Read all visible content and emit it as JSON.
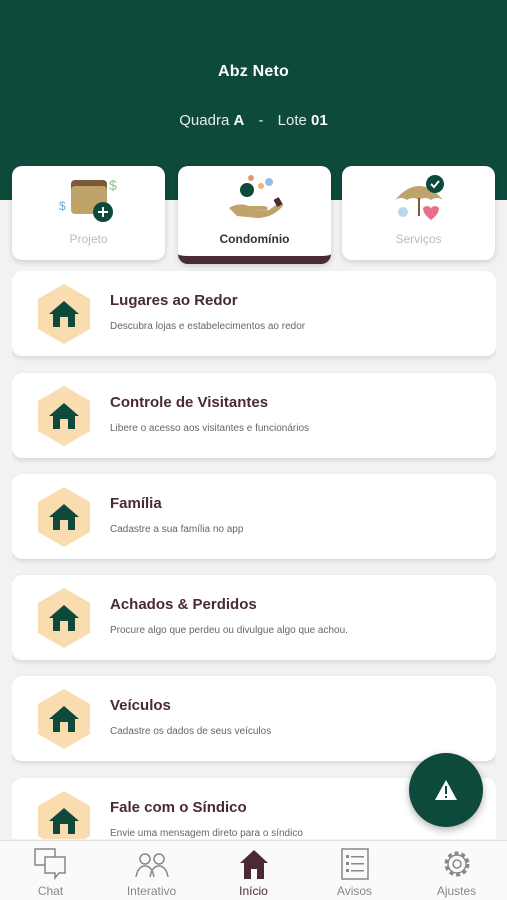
{
  "header": {
    "user_name": "Abz Neto",
    "quadra_label": "Quadra",
    "quadra_value": "A",
    "separator": "-",
    "lote_label": "Lote",
    "lote_value": "01"
  },
  "tabs": [
    {
      "label": "Projeto",
      "icon": "wallet-icon",
      "active": false
    },
    {
      "label": "Condomínio",
      "icon": "hand-coins-icon",
      "active": true
    },
    {
      "label": "Serviços",
      "icon": "umbrella-icon",
      "active": false
    }
  ],
  "list": [
    {
      "title": "Lugares ao Redor",
      "description": "Descubra lojas e estabelecimentos ao redor",
      "icon": "home-icon"
    },
    {
      "title": "Controle de Visitantes",
      "description": "Libere o acesso aos visitantes e funcionários",
      "icon": "home-icon"
    },
    {
      "title": "Família",
      "description": "Cadastre a sua família no app",
      "icon": "home-icon"
    },
    {
      "title": "Achados & Perdidos",
      "description": "Procure algo que perdeu ou divulgue algo que achou.",
      "icon": "home-icon"
    },
    {
      "title": "Veículos",
      "description": "Cadastre os dados de seus veículos",
      "icon": "home-icon"
    },
    {
      "title": "Fale com o Síndico",
      "description": "Envie uma mensagem direto para o síndico",
      "icon": "home-icon"
    }
  ],
  "fab": {
    "icon": "warning-icon"
  },
  "bottom_nav": [
    {
      "label": "Chat",
      "icon": "chat-icon",
      "active": false
    },
    {
      "label": "Interativo",
      "icon": "people-icon",
      "active": false
    },
    {
      "label": "Início",
      "icon": "home-icon",
      "active": true
    },
    {
      "label": "Avisos",
      "icon": "list-icon",
      "active": false
    },
    {
      "label": "Ajustes",
      "icon": "gear-icon",
      "active": false
    }
  ],
  "colors": {
    "primary_green": "#0d4a3b",
    "accent_wine": "#4a2a33",
    "hex_fill": "#f9dcb0"
  }
}
